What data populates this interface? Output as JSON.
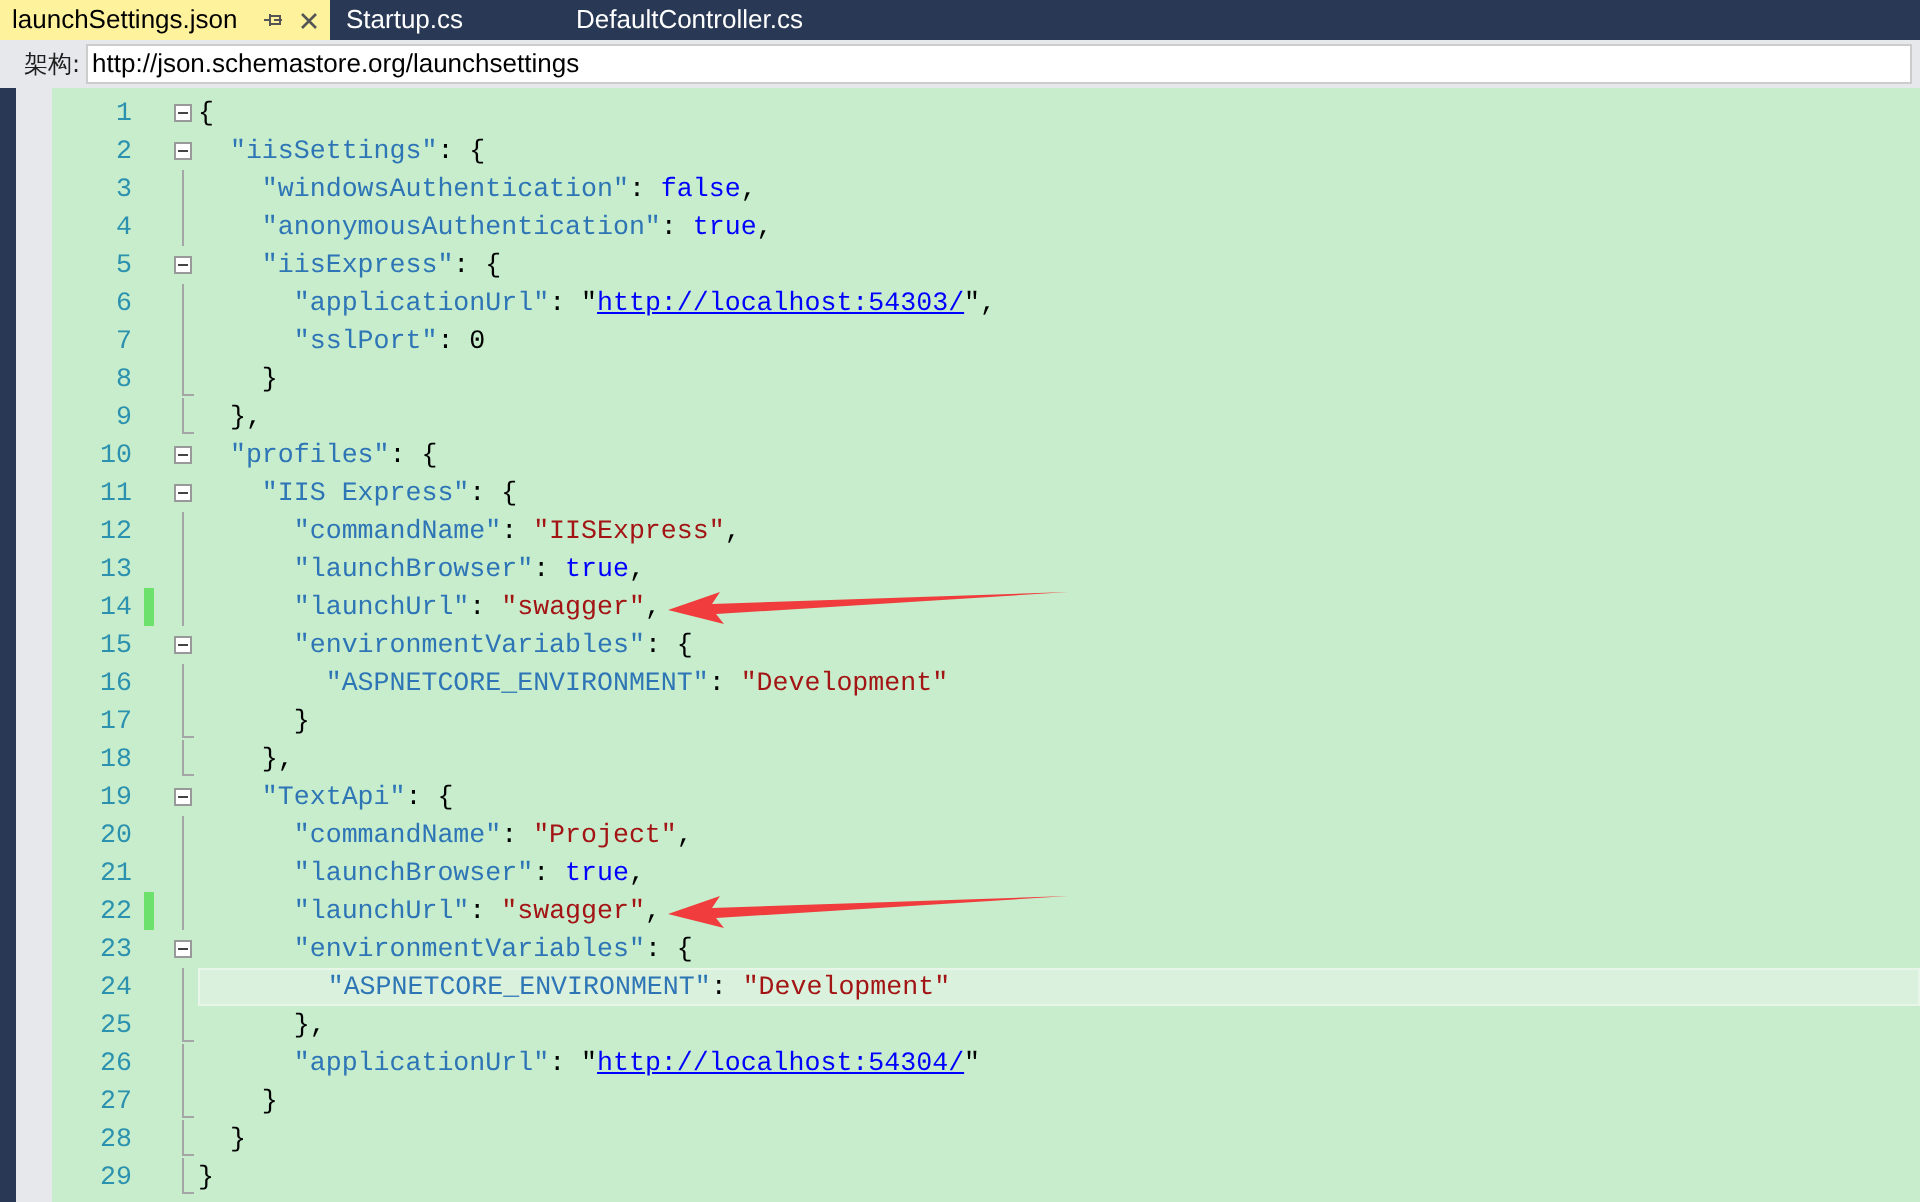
{
  "tabs": [
    {
      "label": "launchSettings.json",
      "selected": true,
      "pinned": true
    },
    {
      "label": "Startup.cs",
      "selected": false,
      "pinned": false
    },
    {
      "label": "DefaultController.cs",
      "selected": false,
      "pinned": false
    }
  ],
  "navigation_bar": {
    "label": "架构:",
    "value": "http://json.schemastore.org/launchsettings"
  },
  "lines": [
    {
      "number": "1",
      "kind": "fold-start",
      "changed": false,
      "current": false,
      "arrow": false,
      "tokens": [
        {
          "kind": "punct",
          "text": "{"
        }
      ]
    },
    {
      "number": "2",
      "kind": "fold-start",
      "changed": false,
      "current": false,
      "arrow": false,
      "tokens": [
        {
          "kind": "key",
          "text": "  \"iisSettings\""
        },
        {
          "kind": "punct",
          "text": ": {"
        }
      ]
    },
    {
      "number": "3",
      "kind": "fold-body",
      "changed": false,
      "current": false,
      "arrow": false,
      "tokens": [
        {
          "kind": "key",
          "text": "    \"windowsAuthentication\""
        },
        {
          "kind": "punct",
          "text": ": "
        },
        {
          "kind": "keyword",
          "text": "false"
        },
        {
          "kind": "punct",
          "text": ","
        }
      ]
    },
    {
      "number": "4",
      "kind": "fold-body",
      "changed": false,
      "current": false,
      "arrow": false,
      "tokens": [
        {
          "kind": "key",
          "text": "    \"anonymousAuthentication\""
        },
        {
          "kind": "punct",
          "text": ": "
        },
        {
          "kind": "keyword",
          "text": "true"
        },
        {
          "kind": "punct",
          "text": ","
        }
      ]
    },
    {
      "number": "5",
      "kind": "fold-start",
      "changed": false,
      "current": false,
      "arrow": false,
      "tokens": [
        {
          "kind": "key",
          "text": "    \"iisExpress\""
        },
        {
          "kind": "punct",
          "text": ": {"
        }
      ]
    },
    {
      "number": "6",
      "kind": "fold-body",
      "changed": false,
      "current": false,
      "arrow": false,
      "tokens": [
        {
          "kind": "key",
          "text": "      \"applicationUrl\""
        },
        {
          "kind": "punct",
          "text": ": \""
        },
        {
          "kind": "link",
          "text": "http://localhost:54303/"
        },
        {
          "kind": "punct",
          "text": "\","
        }
      ]
    },
    {
      "number": "7",
      "kind": "fold-body",
      "changed": false,
      "current": false,
      "arrow": false,
      "tokens": [
        {
          "kind": "key",
          "text": "      \"sslPort\""
        },
        {
          "kind": "punct",
          "text": ": 0"
        }
      ]
    },
    {
      "number": "8",
      "kind": "fold-end",
      "changed": false,
      "current": false,
      "arrow": false,
      "tokens": [
        {
          "kind": "punct",
          "text": "    }"
        }
      ]
    },
    {
      "number": "9",
      "kind": "fold-end",
      "changed": false,
      "current": false,
      "arrow": false,
      "tokens": [
        {
          "kind": "punct",
          "text": "  },"
        }
      ]
    },
    {
      "number": "10",
      "kind": "fold-start",
      "changed": false,
      "current": false,
      "arrow": false,
      "tokens": [
        {
          "kind": "key",
          "text": "  \"profiles\""
        },
        {
          "kind": "punct",
          "text": ": {"
        }
      ]
    },
    {
      "number": "11",
      "kind": "fold-start",
      "changed": false,
      "current": false,
      "arrow": false,
      "tokens": [
        {
          "kind": "key",
          "text": "    \"IIS Express\""
        },
        {
          "kind": "punct",
          "text": ": {"
        }
      ]
    },
    {
      "number": "12",
      "kind": "fold-body",
      "changed": false,
      "current": false,
      "arrow": false,
      "tokens": [
        {
          "kind": "key",
          "text": "      \"commandName\""
        },
        {
          "kind": "punct",
          "text": ": "
        },
        {
          "kind": "string",
          "text": "\"IISExpress\""
        },
        {
          "kind": "punct",
          "text": ","
        }
      ]
    },
    {
      "number": "13",
      "kind": "fold-body",
      "changed": false,
      "current": false,
      "arrow": false,
      "tokens": [
        {
          "kind": "key",
          "text": "      \"launchBrowser\""
        },
        {
          "kind": "punct",
          "text": ": "
        },
        {
          "kind": "keyword",
          "text": "true"
        },
        {
          "kind": "punct",
          "text": ","
        }
      ]
    },
    {
      "number": "14",
      "kind": "fold-body",
      "changed": true,
      "current": false,
      "arrow": true,
      "tokens": [
        {
          "kind": "key",
          "text": "      \"launchUrl\""
        },
        {
          "kind": "punct",
          "text": ": "
        },
        {
          "kind": "string",
          "text": "\"swagger\""
        },
        {
          "kind": "punct",
          "text": ","
        }
      ]
    },
    {
      "number": "15",
      "kind": "fold-start",
      "changed": false,
      "current": false,
      "arrow": false,
      "tokens": [
        {
          "kind": "key",
          "text": "      \"environmentVariables\""
        },
        {
          "kind": "punct",
          "text": ": {"
        }
      ]
    },
    {
      "number": "16",
      "kind": "fold-body",
      "changed": false,
      "current": false,
      "arrow": false,
      "tokens": [
        {
          "kind": "key",
          "text": "        \"ASPNETCORE_ENVIRONMENT\""
        },
        {
          "kind": "punct",
          "text": ": "
        },
        {
          "kind": "string",
          "text": "\"Development\""
        }
      ]
    },
    {
      "number": "17",
      "kind": "fold-end",
      "changed": false,
      "current": false,
      "arrow": false,
      "tokens": [
        {
          "kind": "punct",
          "text": "      }"
        }
      ]
    },
    {
      "number": "18",
      "kind": "fold-end",
      "changed": false,
      "current": false,
      "arrow": false,
      "tokens": [
        {
          "kind": "punct",
          "text": "    },"
        }
      ]
    },
    {
      "number": "19",
      "kind": "fold-start",
      "changed": false,
      "current": false,
      "arrow": false,
      "tokens": [
        {
          "kind": "key",
          "text": "    \"TextApi\""
        },
        {
          "kind": "punct",
          "text": ": {"
        }
      ]
    },
    {
      "number": "20",
      "kind": "fold-body",
      "changed": false,
      "current": false,
      "arrow": false,
      "tokens": [
        {
          "kind": "key",
          "text": "      \"commandName\""
        },
        {
          "kind": "punct",
          "text": ": "
        },
        {
          "kind": "string",
          "text": "\"Project\""
        },
        {
          "kind": "punct",
          "text": ","
        }
      ]
    },
    {
      "number": "21",
      "kind": "fold-body",
      "changed": false,
      "current": false,
      "arrow": false,
      "tokens": [
        {
          "kind": "key",
          "text": "      \"launchBrowser\""
        },
        {
          "kind": "punct",
          "text": ": "
        },
        {
          "kind": "keyword",
          "text": "true"
        },
        {
          "kind": "punct",
          "text": ","
        }
      ]
    },
    {
      "number": "22",
      "kind": "fold-body",
      "changed": true,
      "current": false,
      "arrow": true,
      "tokens": [
        {
          "kind": "key",
          "text": "      \"launchUrl\""
        },
        {
          "kind": "punct",
          "text": ": "
        },
        {
          "kind": "string",
          "text": "\"swagger\""
        },
        {
          "kind": "punct",
          "text": ","
        }
      ]
    },
    {
      "number": "23",
      "kind": "fold-start",
      "changed": false,
      "current": false,
      "arrow": false,
      "tokens": [
        {
          "kind": "key",
          "text": "      \"environmentVariables\""
        },
        {
          "kind": "punct",
          "text": ": {"
        }
      ]
    },
    {
      "number": "24",
      "kind": "fold-body",
      "changed": false,
      "current": true,
      "arrow": false,
      "tokens": [
        {
          "kind": "key",
          "text": "        \"ASPNETCORE_ENVIRONMENT\""
        },
        {
          "kind": "punct",
          "text": ": "
        },
        {
          "kind": "string",
          "text": "\"Development\""
        }
      ]
    },
    {
      "number": "25",
      "kind": "fold-end",
      "changed": false,
      "current": false,
      "arrow": false,
      "tokens": [
        {
          "kind": "punct",
          "text": "      },"
        }
      ]
    },
    {
      "number": "26",
      "kind": "fold-body",
      "changed": false,
      "current": false,
      "arrow": false,
      "tokens": [
        {
          "kind": "key",
          "text": "      \"applicationUrl\""
        },
        {
          "kind": "punct",
          "text": ": \""
        },
        {
          "kind": "link",
          "text": "http://localhost:54304/"
        },
        {
          "kind": "punct",
          "text": "\""
        }
      ]
    },
    {
      "number": "27",
      "kind": "fold-end",
      "changed": false,
      "current": false,
      "arrow": false,
      "tokens": [
        {
          "kind": "punct",
          "text": "    }"
        }
      ]
    },
    {
      "number": "28",
      "kind": "fold-end",
      "changed": false,
      "current": false,
      "arrow": false,
      "tokens": [
        {
          "kind": "punct",
          "text": "  }"
        }
      ]
    },
    {
      "number": "29",
      "kind": "fold-end",
      "changed": false,
      "current": false,
      "arrow": false,
      "tokens": [
        {
          "kind": "punct",
          "text": "}"
        }
      ]
    }
  ]
}
